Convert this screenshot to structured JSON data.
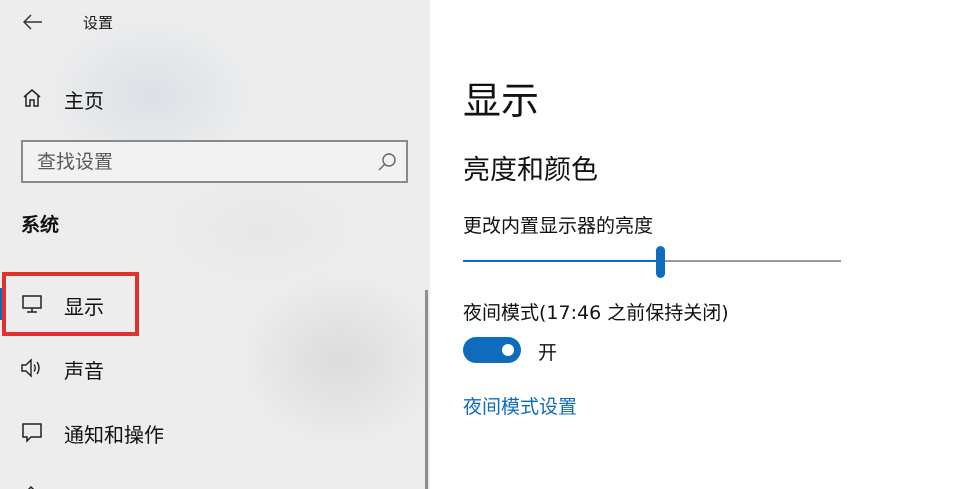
{
  "window": {
    "title": "设置"
  },
  "sidebar": {
    "home_label": "主页",
    "search": {
      "placeholder": "查找设置"
    },
    "section_title": "系统",
    "items": [
      {
        "label": "显示",
        "icon": "monitor-icon",
        "selected": true
      },
      {
        "label": "声音",
        "icon": "speaker-icon",
        "selected": false
      },
      {
        "label": "通知和操作",
        "icon": "notification-icon",
        "selected": false
      }
    ]
  },
  "main": {
    "page_title": "显示",
    "brightness_group": {
      "title": "亮度和颜色",
      "brightness_label": "更改内置显示器的亮度",
      "brightness_value_percent": 52
    },
    "night_light": {
      "label": "夜间模式(17:46 之前保持关闭)",
      "toggle_on": true,
      "toggle_state_label": "开",
      "settings_link": "夜间模式设置"
    }
  },
  "colors": {
    "accent": "#0f6cbd",
    "highlight_box": "#e03131",
    "sidebar_bg": "#ededed"
  }
}
